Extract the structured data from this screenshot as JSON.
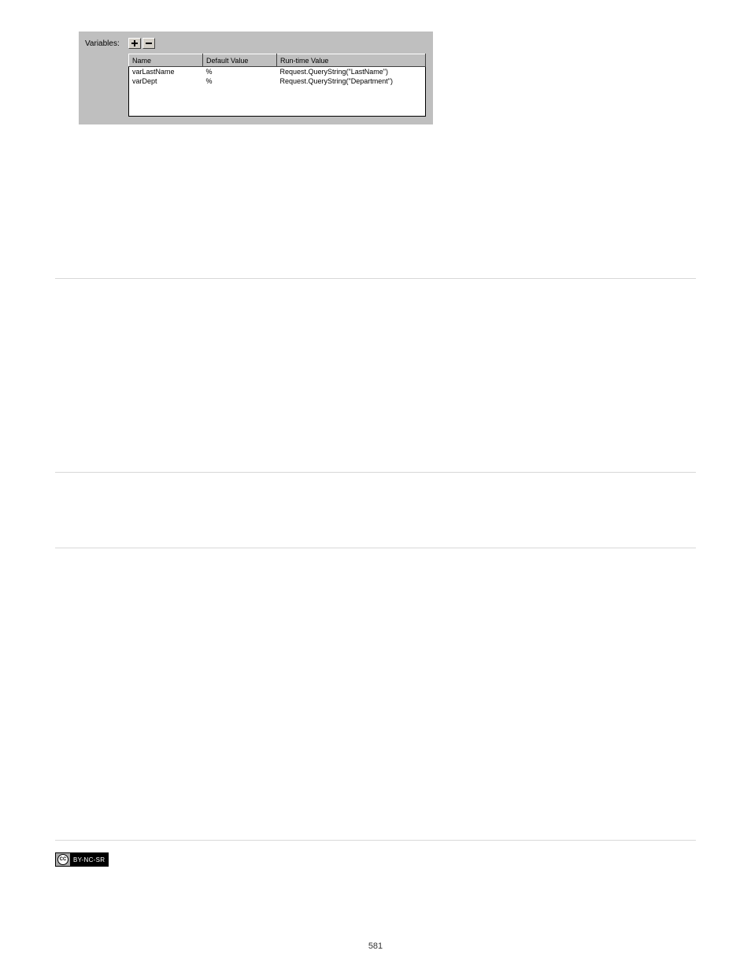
{
  "panel": {
    "label": "Variables:",
    "add_btn_title": "Add",
    "remove_btn_title": "Remove",
    "columns": {
      "name": "Name",
      "default": "Default Value",
      "runtime": "Run-time Value"
    },
    "rows": [
      {
        "name": "varLastName",
        "default": "%",
        "runtime": "Request.QueryString(\"LastName\")"
      },
      {
        "name": "varDept",
        "default": "%",
        "runtime": "Request.QueryString(\"Department\")"
      }
    ]
  },
  "license_badge": {
    "cc": "CC",
    "text": "BY-NC-SR"
  },
  "page_number": "581"
}
